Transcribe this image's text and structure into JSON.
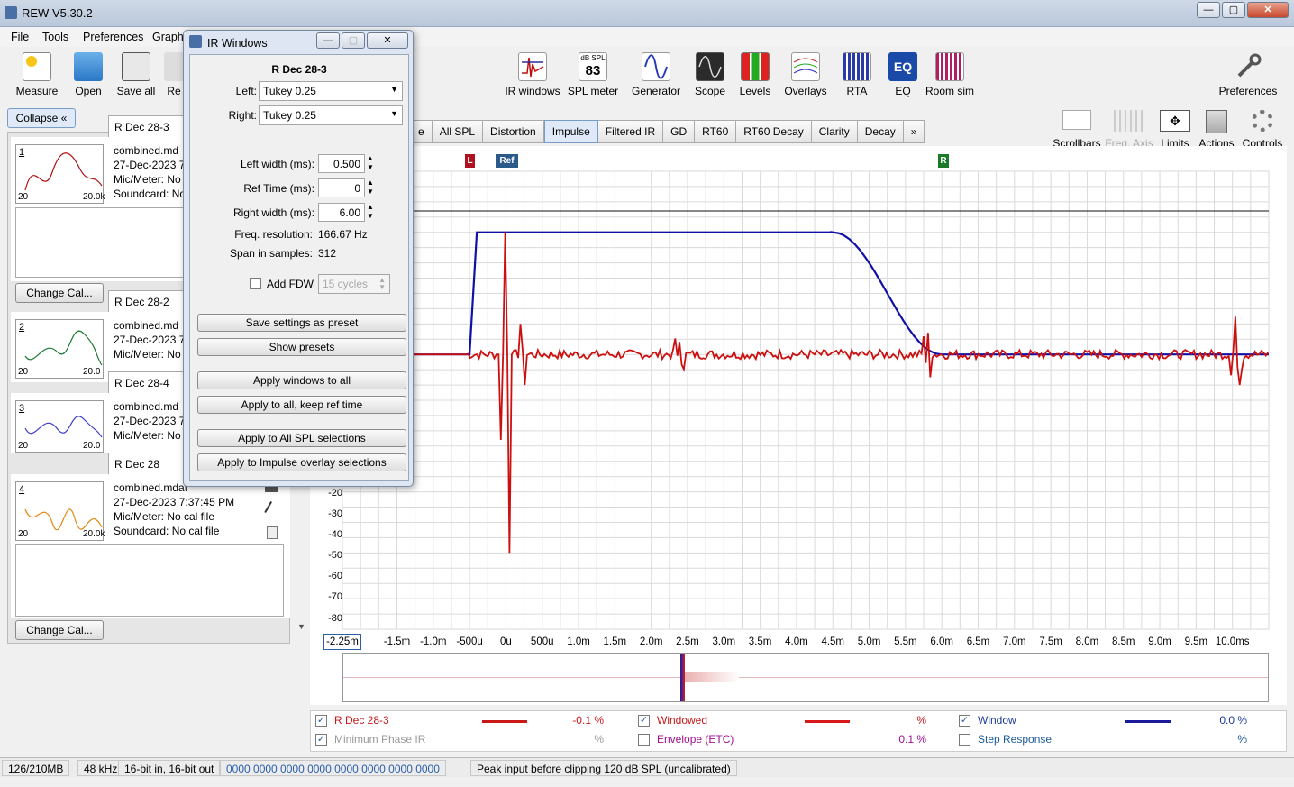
{
  "app": {
    "title": "REW V5.30.2"
  },
  "menu": [
    "File",
    "Tools",
    "Preferences",
    "Graph"
  ],
  "left_toolbar": [
    {
      "label": "Measure",
      "icon": "measure-icon"
    },
    {
      "label": "Open",
      "icon": "folder-icon"
    },
    {
      "label": "Save all",
      "icon": "save-icon"
    },
    {
      "label": "Re",
      "icon": "remove-icon"
    }
  ],
  "main_toolbar": [
    {
      "label": "IR windows",
      "icon": "ir-windows-icon"
    },
    {
      "label": "SPL meter",
      "icon": "spl-meter-icon",
      "badge_top": "dB SPL",
      "badge_value": "83"
    },
    {
      "label": "Generator",
      "icon": "generator-icon"
    },
    {
      "label": "Scope",
      "icon": "scope-icon"
    },
    {
      "label": "Levels",
      "icon": "levels-icon"
    },
    {
      "label": "Overlays",
      "icon": "overlays-icon"
    },
    {
      "label": "RTA",
      "icon": "rta-icon"
    },
    {
      "label": "EQ",
      "icon": "eq-icon"
    },
    {
      "label": "Room sim",
      "icon": "room-sim-icon"
    }
  ],
  "preferences_label": "Preferences",
  "graph_tools": [
    "Scrollbars",
    "Freq. Axis",
    "Limits",
    "Actions",
    "Controls"
  ],
  "collapse_label": "Collapse",
  "tabs": [
    "e",
    "All SPL",
    "Distortion",
    "Impulse",
    "Filtered IR",
    "GD",
    "RT60",
    "RT60 Decay",
    "Clarity",
    "Decay"
  ],
  "active_tab": "Impulse",
  "tabs_more": "»",
  "measurements": [
    {
      "num": "1",
      "name": "R Dec 28-3",
      "file": "combined.md",
      "date": "27-Dec-2023 7",
      "mic": "Mic/Meter: No",
      "soundcard": "Soundcard: No",
      "tl": "20",
      "tr": "20.0k",
      "color": "#b01010"
    },
    {
      "num": "2",
      "name": "R Dec 28-2",
      "file": "combined.md",
      "date": "27-Dec-2023 7",
      "mic": "Mic/Meter: No",
      "soundcard": "",
      "tl": "20",
      "tr": "20.0",
      "color": "#1a7a30"
    },
    {
      "num": "3",
      "name": "R Dec 28-4",
      "file": "combined.md",
      "date": "27-Dec-2023 7",
      "mic": "Mic/Meter: No",
      "soundcard": "",
      "tl": "20",
      "tr": "20.0",
      "color": "#3d3dc8"
    },
    {
      "num": "4",
      "name": "R Dec 28",
      "file": "combined.mdat",
      "date": "27-Dec-2023 7:37:45 PM",
      "mic": "Mic/Meter: No cal file",
      "soundcard": "Soundcard: No cal file",
      "tl": "20",
      "tr": "20.0k",
      "color": "#e08a10"
    }
  ],
  "change_cal_label": "Change Cal...",
  "dialog": {
    "title": "IR Windows",
    "measurement": "R Dec 28-3",
    "left_label": "Left:",
    "left_value": "Tukey 0.25",
    "right_label": "Right:",
    "right_value": "Tukey 0.25",
    "left_width_label": "Left width (ms):",
    "left_width": "0.500",
    "ref_time_label": "Ref Time (ms):",
    "ref_time": "0",
    "right_width_label": "Right width (ms):",
    "right_width": "6.00",
    "freq_res_label": "Freq. resolution:",
    "freq_res": "166.67 Hz",
    "span_label": "Span in samples:",
    "span": "312",
    "fdw_label": "Add FDW",
    "fdw_value": "15 cycles",
    "buttons": [
      "Save settings as preset",
      "Show presets",
      "Apply windows to all",
      "Apply to all, keep ref time",
      "Apply to All SPL selections",
      "Apply to Impulse overlay selections"
    ]
  },
  "markers": {
    "left": "L",
    "ref": "Ref",
    "right": "R"
  },
  "chart_data": {
    "type": "line",
    "x_unit": "ms",
    "x_tick_labels": [
      "-2.25m",
      "-1.5m",
      "-1.0m",
      "-500u",
      "0u",
      "500u",
      "1.0m",
      "1.5m",
      "2.0m",
      "2.5m",
      "3.0m",
      "3.5m",
      "4.0m",
      "4.5m",
      "5.0m",
      "5.5m",
      "6.0m",
      "6.5m",
      "7.0m",
      "7.5m",
      "8.0m",
      "8.5m",
      "9.0m",
      "9.5m",
      "10.0ms"
    ],
    "y_tick_labels": [
      "-20",
      "-30",
      "-40",
      "-50",
      "-60",
      "-70",
      "-80"
    ],
    "xlim": [
      -2.25,
      10.5
    ],
    "ylim": [
      -90,
      60
    ],
    "window": {
      "left_start_ms": -0.5,
      "flat_start_ms": -0.4,
      "flat_end_ms": 4.5,
      "right_end_ms": 6.0,
      "level_percent": 100
    },
    "series": [
      {
        "name": "Window",
        "color": "#1010a8"
      },
      {
        "name": "Windowed",
        "color": "#cc1010"
      }
    ]
  },
  "legend": [
    {
      "label": "R Dec 28-3",
      "checked": true,
      "line": "#c81818",
      "value": "-0.1 %",
      "color": "#c81818"
    },
    {
      "label": "Windowed",
      "checked": true,
      "line": "#d81818",
      "value": "%",
      "color": "#c81818"
    },
    {
      "label": "Window",
      "checked": true,
      "line": "#1a1a9a",
      "value": "0.0 %",
      "color": "#1a3a9a"
    },
    {
      "label": "Minimum Phase IR",
      "checked": true,
      "line": "",
      "value": "%",
      "color": "#999999"
    },
    {
      "label": "Envelope (ETC)",
      "checked": false,
      "line": "",
      "value": "0.1 %",
      "color": "#a01090"
    },
    {
      "label": "Step Response",
      "checked": false,
      "line": "",
      "value": "%",
      "color": "#1a5a9a"
    }
  ],
  "status": {
    "memory": "126/210MB",
    "rate": "48 kHz",
    "bits": "16-bit in, 16-bit out",
    "levels": "0000 0000  0000 0000  0000 0000  0000 0000",
    "peak": "Peak input before clipping 120 dB SPL (uncalibrated)"
  }
}
